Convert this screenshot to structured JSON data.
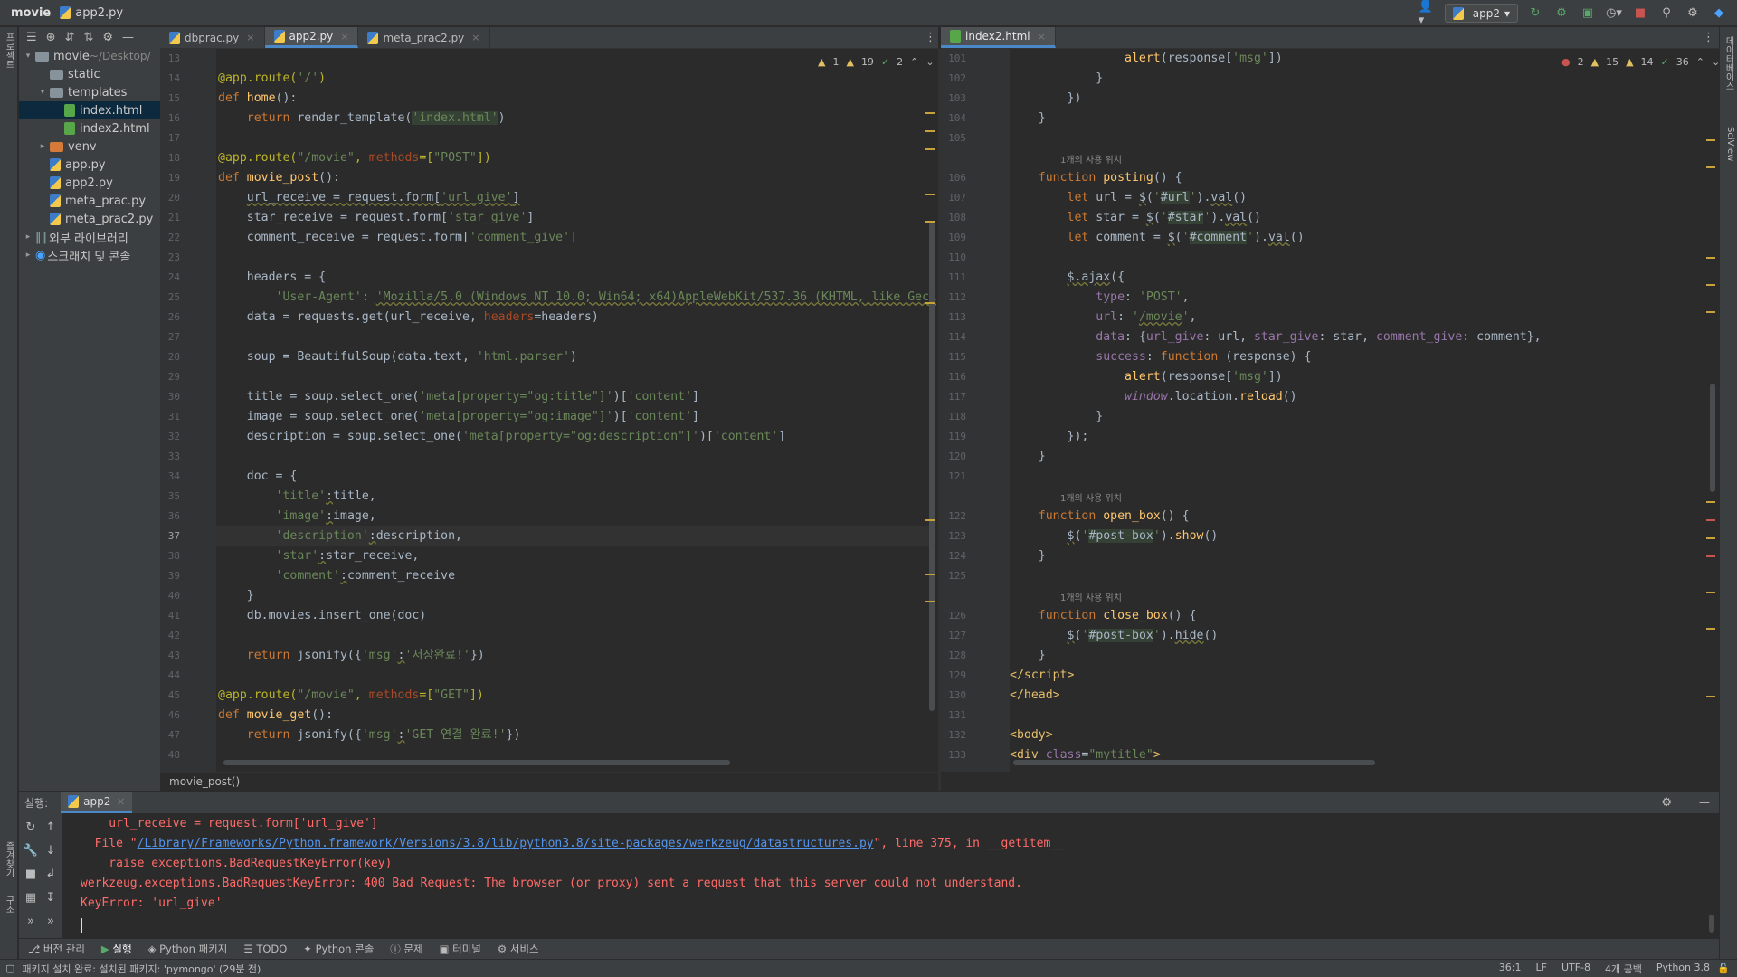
{
  "titlebar": {
    "project": "movie",
    "file": "app2.py",
    "run_config": "app2"
  },
  "left_strip": {
    "project_tab": "프로젝트",
    "bookmark_tab": "즐겨찾기",
    "structure_tab": "구조"
  },
  "right_strip": {
    "database_tab": "데이터베이스",
    "sciview_tab": "SciView"
  },
  "project_tree": [
    {
      "label": "movie",
      "suffix": "~/Desktop/",
      "type": "folder",
      "depth": 0,
      "arrow": "down"
    },
    {
      "label": "static",
      "type": "folder",
      "depth": 1,
      "arrow": ""
    },
    {
      "label": "templates",
      "type": "folder",
      "depth": 1,
      "arrow": "down"
    },
    {
      "label": "index.html",
      "type": "html",
      "depth": 2,
      "arrow": "",
      "selected": true
    },
    {
      "label": "index2.html",
      "type": "html",
      "depth": 2,
      "arrow": ""
    },
    {
      "label": "venv",
      "type": "folder-orange",
      "depth": 1,
      "arrow": "right"
    },
    {
      "label": "app.py",
      "type": "py",
      "depth": 1,
      "arrow": ""
    },
    {
      "label": "app2.py",
      "type": "py",
      "depth": 1,
      "arrow": ""
    },
    {
      "label": "meta_prac.py",
      "type": "py",
      "depth": 1,
      "arrow": ""
    },
    {
      "label": "meta_prac2.py",
      "type": "py",
      "depth": 1,
      "arrow": ""
    },
    {
      "label": "외부 라이브러리",
      "type": "lib",
      "depth": 0,
      "arrow": "right"
    },
    {
      "label": "스크래치 및 콘솔",
      "type": "scratch",
      "depth": 0,
      "arrow": "right"
    }
  ],
  "left_tabs": [
    {
      "label": "dbprac.py",
      "active": false
    },
    {
      "label": "app2.py",
      "active": true
    },
    {
      "label": "meta_prac2.py",
      "active": false
    }
  ],
  "right_tabs": [
    {
      "label": "index2.html",
      "active": true
    }
  ],
  "left_inspection": {
    "warn_a": "1",
    "warn_b": "19",
    "ok": "2"
  },
  "right_inspection": {
    "err": "2",
    "warn_a": "15",
    "warn_b": "14",
    "ok": "36"
  },
  "left_lines": [
    {
      "n": "13",
      "code": ""
    },
    {
      "n": "14",
      "code": "<span class='dec'>@app.route(<span class='str'>'/'</span>)</span>"
    },
    {
      "n": "15",
      "code": "<span class='kw'>def </span><span class='fn'>home</span>():"
    },
    {
      "n": "16",
      "code": "    <span class='kw'>return </span>render_template(<span class='str hlstr'>'index.html'</span>)"
    },
    {
      "n": "17",
      "code": ""
    },
    {
      "n": "18",
      "code": "<span class='dec'>@app.route(<span class='str'>\"/movie\"</span>, <span class='par'>methods</span>=[<span class='str'>\"POST\"</span>])</span>"
    },
    {
      "n": "19",
      "code": "<span class='kw'>def </span><span class='fn'>movie_post</span>():"
    },
    {
      "n": "20",
      "code": "    <span class='ul'>url_receive = request.form[<span class='str'>'url_give'</span>]</span>"
    },
    {
      "n": "21",
      "code": "    star_receive = request.form[<span class='str'>'star_give'</span>]"
    },
    {
      "n": "22",
      "code": "    comment_receive = request.form[<span class='str'>'comment_give'</span>]"
    },
    {
      "n": "23",
      "code": ""
    },
    {
      "n": "24",
      "code": "    headers = {"
    },
    {
      "n": "25",
      "code": "        <span class='str'>'User-Agent'</span>: <span class='str ul'>'Mozilla/5.0 (Windows NT 10.0; Win64; x64)AppleWebKit/537.36 (KHTML, like Geck</span>"
    },
    {
      "n": "26",
      "code": "    data = requests.get(url_receive, <span class='par'>headers</span>=headers)"
    },
    {
      "n": "27",
      "code": ""
    },
    {
      "n": "28",
      "code": "    soup = BeautifulSoup(data.text, <span class='str'>'html.parser'</span>)"
    },
    {
      "n": "29",
      "code": ""
    },
    {
      "n": "30",
      "code": "    title = soup.select_one(<span class='str'>'meta[property=\"og:title\"]'</span>)[<span class='str'>'content'</span>]"
    },
    {
      "n": "31",
      "code": "    image = soup.select_one(<span class='str'>'meta[property=\"og:image\"]'</span>)[<span class='str'>'content'</span>]"
    },
    {
      "n": "32",
      "code": "    description = soup.select_one(<span class='str'>'meta[property=\"og:description\"]'</span>)[<span class='str'>'content'</span>]"
    },
    {
      "n": "33",
      "code": ""
    },
    {
      "n": "34",
      "code": "    doc = {"
    },
    {
      "n": "35",
      "code": "        <span class='str'>'title'</span><span class='ul'>:</span>title,"
    },
    {
      "n": "36",
      "code": "        <span class='str'>'image'</span><span class='ul'>:</span>image,"
    },
    {
      "n": "37",
      "code": "        <span class='str'>'description'</span><span class='ul'>:</span>description,"
    },
    {
      "n": "38",
      "code": "        <span class='str'>'star'</span><span class='ul'>:</span>star_receive,"
    },
    {
      "n": "39",
      "code": "        <span class='str'>'comment'</span><span class='ul'>:</span>comment_receive"
    },
    {
      "n": "40",
      "code": "    }"
    },
    {
      "n": "41",
      "code": "    db.movies.insert_one(doc)"
    },
    {
      "n": "42",
      "code": ""
    },
    {
      "n": "43",
      "code": "    <span class='kw'>return </span>jsonify({<span class='str'>'msg'</span><span class='ul'>:</span><span class='str'>'저장완료!'</span>})"
    },
    {
      "n": "44",
      "code": ""
    },
    {
      "n": "45",
      "code": "<span class='dec'>@app.route(<span class='str'>\"/movie\"</span>, <span class='par'>methods</span>=[<span class='str'>\"GET\"</span>])</span>"
    },
    {
      "n": "46",
      "code": "<span class='kw'>def </span><span class='fn'>movie_get</span>():"
    },
    {
      "n": "47",
      "code": "    <span class='kw'>return </span>jsonify({<span class='str'>'msg'</span><span class='ul'>:</span><span class='str'>'GET 연결 완료!'</span>})"
    },
    {
      "n": "48",
      "code": ""
    }
  ],
  "usage_label": "1개의 사용 위치",
  "right_lines": [
    {
      "n": "101",
      "code": "                <span class='fn'>alert</span>(response[<span class='str'>'msg'</span>])"
    },
    {
      "n": "102",
      "code": "            }"
    },
    {
      "n": "103",
      "code": "        })"
    },
    {
      "n": "104",
      "code": "    }"
    },
    {
      "n": "105",
      "code": ""
    },
    {
      "usage": true
    },
    {
      "n": "106",
      "code": "    <span class='kw'>function </span><span class='fn'>posting</span>() {"
    },
    {
      "n": "107",
      "code": "        <span class='kw'>let </span>url = <span class='ul'>$</span>(<span class='str'>'</span><span class='hlstr'>#url</span><span class='str'>'</span>).<span class='ul'>val</span>()"
    },
    {
      "n": "108",
      "code": "        <span class='kw'>let </span>star = <span class='ul'>$</span>(<span class='str'>'</span><span class='hlstr'>#star</span><span class='str'>'</span>).<span class='ul'>val</span>()"
    },
    {
      "n": "109",
      "code": "        <span class='kw'>let </span>comment = <span class='ul'>$</span>(<span class='str'>'</span><span class='hlstr'>#comment</span><span class='str'>'</span>).<span class='ul'>val</span>()"
    },
    {
      "n": "110",
      "code": ""
    },
    {
      "n": "111",
      "code": "        <span class='ul'>$.ajax</span>({"
    },
    {
      "n": "112",
      "code": "            <span class='prop'>type</span>: <span class='str'>'POST'</span>,"
    },
    {
      "n": "113",
      "code": "            <span class='prop'>url</span>: <span class='str'>'<span class=\"ul\">/movie</span>'</span>,"
    },
    {
      "n": "114",
      "code": "            <span class='prop'>data</span>: {<span class='prop'>url_give</span>: url, <span class='prop'>star_give</span>: star, <span class='prop'>comment_give</span>: comment},"
    },
    {
      "n": "115",
      "code": "            <span class='prop'>success</span>: <span class='kw'>function </span>(response) {"
    },
    {
      "n": "116",
      "code": "                <span class='fn'>alert</span>(response[<span class='str'>'msg'</span>])"
    },
    {
      "n": "117",
      "code": "                <span class='it'>window</span>.location.<span class='fn'>reload</span>()"
    },
    {
      "n": "118",
      "code": "            }"
    },
    {
      "n": "119",
      "code": "        });"
    },
    {
      "n": "120",
      "code": "    }"
    },
    {
      "n": "121",
      "code": ""
    },
    {
      "usage": true
    },
    {
      "n": "122",
      "code": "    <span class='kw'>function </span><span class='fn'>open_box</span>() {"
    },
    {
      "n": "123",
      "code": "        <span class='ul'>$</span>(<span class='str'>'</span><span class='hlstr'>#post-box</span><span class='str'>'</span>).<span class='fn'>show</span>()"
    },
    {
      "n": "124",
      "code": "    }"
    },
    {
      "n": "125",
      "code": ""
    },
    {
      "usage": true
    },
    {
      "n": "126",
      "code": "    <span class='kw'>function </span><span class='fn'>close_box</span>() {"
    },
    {
      "n": "127",
      "code": "        <span class='ul'>$</span>(<span class='str'>'</span><span class='hlstr'>#post-box</span><span class='str'>'</span>).<span class='ul'>hide</span>()"
    },
    {
      "n": "128",
      "code": "    }"
    },
    {
      "n": "129",
      "code": "<span class='tag'>&lt;/script&gt;</span>"
    },
    {
      "n": "130",
      "code": "<span class='tag'>&lt;/head&gt;</span>"
    },
    {
      "n": "131",
      "code": ""
    },
    {
      "n": "132",
      "code": "<span class='tag'>&lt;body&gt;</span>"
    },
    {
      "n": "133",
      "code": "<span class='tag'>&lt;div </span><span class='prop'>class</span>=<span class='str'>\"mytitle\"</span><span class='tag'>&gt;</span>"
    }
  ],
  "editor_breadcrumb": "movie_post()",
  "run_panel": {
    "label": "실행:",
    "tab": "app2",
    "console_lines": [
      {
        "text": "    url_receive = request.form['url_give']"
      },
      {
        "prefix": "  File \"",
        "link": "/Library/Frameworks/Python.framework/Versions/3.8/lib/python3.8/site-packages/werkzeug/datastructures.py",
        "suffix": "\", line 375, in __getitem__"
      },
      {
        "text": "    raise exceptions.BadRequestKeyError(key)"
      },
      {
        "text": "werkzeug.exceptions.BadRequestKeyError: 400 Bad Request: The browser (or proxy) sent a request that this server could not understand."
      },
      {
        "text": "KeyError: 'url_give'"
      }
    ]
  },
  "bottom_tabs": [
    {
      "label": "버전 관리",
      "icon": "vcs-icon"
    },
    {
      "label": "실행",
      "icon": "run-icon",
      "active": true
    },
    {
      "label": "Python 패키지",
      "icon": "package-icon"
    },
    {
      "label": "TODO",
      "icon": "todo-icon"
    },
    {
      "label": "Python 콘솔",
      "icon": "python-console-icon"
    },
    {
      "label": "문제",
      "icon": "problems-icon"
    },
    {
      "label": "터미널",
      "icon": "terminal-icon"
    },
    {
      "label": "서비스",
      "icon": "services-icon"
    }
  ],
  "statusbar": {
    "message": "패키지 설치 완료: 설치된 패키지: 'pymongo' (29분 전)",
    "position": "36:1",
    "line_sep": "LF",
    "encoding": "UTF-8",
    "indent": "4개 공백",
    "interpreter": "Python 3.8"
  }
}
